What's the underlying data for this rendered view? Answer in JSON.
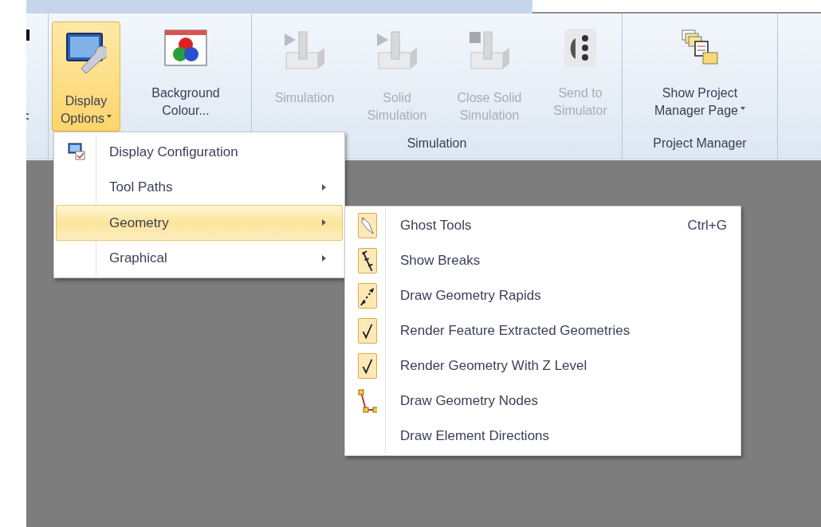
{
  "ribbon": {
    "groups": [
      {
        "buttons": [
          {
            "lines": [
              "Display",
              "Options"
            ],
            "dropdown": true,
            "disabled": false,
            "selected": true
          },
          {
            "lines": [
              "Background",
              "Colour..."
            ],
            "dropdown": false,
            "disabled": false,
            "selected": false
          }
        ]
      },
      {
        "label": "Simulation",
        "buttons": [
          {
            "lines": [
              "Simulation"
            ],
            "dropdown": false,
            "disabled": true,
            "selected": false
          },
          {
            "lines": [
              "Solid",
              "Simulation"
            ],
            "dropdown": false,
            "disabled": true,
            "selected": false
          },
          {
            "lines": [
              "Close Solid",
              "Simulation"
            ],
            "dropdown": false,
            "disabled": true,
            "selected": false
          },
          {
            "lines": [
              "Send to",
              "Simulator"
            ],
            "dropdown": false,
            "disabled": true,
            "selected": false
          }
        ]
      },
      {
        "label": "Project Manager",
        "buttons": [
          {
            "lines": [
              "Show Project",
              "Manager Page"
            ],
            "dropdown": true,
            "disabled": false,
            "selected": false
          }
        ]
      }
    ]
  },
  "display_menu": {
    "items": [
      {
        "label": "Display Configuration",
        "submenu": false,
        "selected": false
      },
      {
        "label": "Tool Paths",
        "submenu": true,
        "selected": false
      },
      {
        "label": "Geometry",
        "submenu": true,
        "selected": true
      },
      {
        "label": "Graphical",
        "submenu": true,
        "selected": false
      }
    ]
  },
  "geometry_menu": {
    "items": [
      {
        "label": "Ghost Tools",
        "shortcut": "Ctrl+G",
        "checked": true
      },
      {
        "label": "Show Breaks",
        "checked": true
      },
      {
        "label": "Draw Geometry Rapids",
        "checked": true
      },
      {
        "label": "Render Feature Extracted Geometries",
        "checked": true
      },
      {
        "label": "Render Geometry With Z Level",
        "checked": true
      },
      {
        "label": "Draw Geometry Nodes",
        "checked": false
      },
      {
        "label": "Draw Element Directions",
        "checked": false
      }
    ]
  }
}
